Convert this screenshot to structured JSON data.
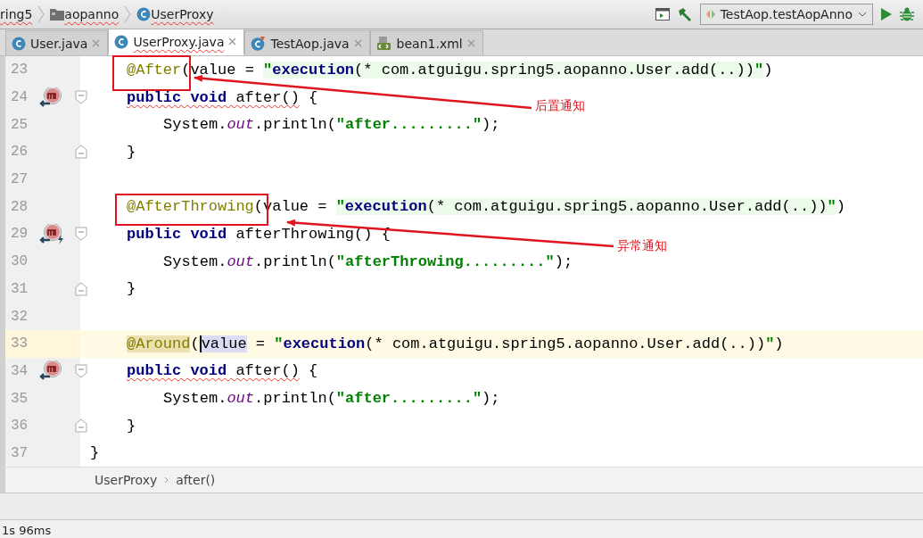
{
  "nav_bar": {
    "breadcrumbs": [
      {
        "label": "ring5",
        "kind": "module"
      },
      {
        "label": "aopanno",
        "kind": "package"
      },
      {
        "label": "UserProxy",
        "kind": "class"
      }
    ],
    "run_config": "TestAop.testAopAnno"
  },
  "tabs": [
    {
      "label": "User.java",
      "kind": "class",
      "selected": false
    },
    {
      "label": "UserProxy.java",
      "kind": "class",
      "selected": true
    },
    {
      "label": "TestAop.java",
      "kind": "test",
      "selected": false
    },
    {
      "label": "bean1.xml",
      "kind": "xml",
      "selected": false
    }
  ],
  "editor": {
    "lines": [
      {
        "number": "23",
        "current": false,
        "kind": "member",
        "tokens": [
          {
            "t": "@After",
            "kind": "annotation"
          },
          {
            "t": "(value = ",
            "kind": "plain"
          },
          {
            "t": "\"",
            "kind": "string-pc"
          },
          {
            "t": "execution",
            "kind": "pc-keyword"
          },
          {
            "t": "(* com.atguigu.spring5.aopanno.User.add(..))",
            "kind": "pc"
          },
          {
            "t": "\"",
            "kind": "string-pc"
          },
          {
            "t": ")",
            "kind": "plain"
          }
        ]
      },
      {
        "number": "24",
        "current": false,
        "kind": "member",
        "marker": {
          "kind": "override"
        },
        "fold": {
          "kind": "start"
        },
        "tokens": [
          {
            "t": "public void",
            "kind": "keyword",
            "squiggle": true
          },
          {
            "t": " after()",
            "kind": "plain",
            "squiggle": true
          },
          {
            "t": " {",
            "kind": "plain"
          }
        ]
      },
      {
        "number": "25",
        "current": false,
        "kind": "statement",
        "tokens": [
          {
            "t": "System.",
            "kind": "plain"
          },
          {
            "t": "out",
            "kind": "field"
          },
          {
            "t": ".println(",
            "kind": "plain"
          },
          {
            "t": "\"after.........\"",
            "kind": "string"
          },
          {
            "t": ");",
            "kind": "plain"
          }
        ]
      },
      {
        "number": "26",
        "current": false,
        "kind": "member",
        "fold": {
          "kind": "end"
        },
        "tokens": [
          {
            "t": "}",
            "kind": "plain"
          }
        ]
      },
      {
        "number": "27",
        "current": false
      },
      {
        "number": "28",
        "current": false,
        "kind": "member",
        "tokens": [
          {
            "t": "@AfterThrowing",
            "kind": "annotation"
          },
          {
            "t": "(value = ",
            "kind": "plain"
          },
          {
            "t": "\"",
            "kind": "string-pc"
          },
          {
            "t": "execution",
            "kind": "pc-keyword"
          },
          {
            "t": "(* com.atguigu.spring5.aopanno.User.add(..))",
            "kind": "pc"
          },
          {
            "t": "\"",
            "kind": "string-pc"
          },
          {
            "t": ")",
            "kind": "plain"
          }
        ]
      },
      {
        "number": "29",
        "current": false,
        "kind": "member",
        "marker": {
          "kind": "override-throws"
        },
        "fold": {
          "kind": "start"
        },
        "tokens": [
          {
            "t": "public void",
            "kind": "keyword"
          },
          {
            "t": " afterThrowing() {",
            "kind": "plain"
          }
        ]
      },
      {
        "number": "30",
        "current": false,
        "kind": "statement",
        "tokens": [
          {
            "t": "System.",
            "kind": "plain"
          },
          {
            "t": "out",
            "kind": "field"
          },
          {
            "t": ".println(",
            "kind": "plain"
          },
          {
            "t": "\"afterThrowing.........\"",
            "kind": "string"
          },
          {
            "t": ");",
            "kind": "plain"
          }
        ]
      },
      {
        "number": "31",
        "current": false,
        "kind": "member",
        "fold": {
          "kind": "end"
        },
        "tokens": [
          {
            "t": "}",
            "kind": "plain"
          }
        ]
      },
      {
        "number": "32",
        "current": false
      },
      {
        "number": "33",
        "current": true,
        "kind": "member",
        "tokens": [
          {
            "t": "@Around",
            "kind": "annotation-match"
          },
          {
            "t": "(",
            "kind": "plain"
          },
          {
            "t": "value",
            "kind": "usage-caret"
          },
          {
            "t": " = ",
            "kind": "plain"
          },
          {
            "t": "\"",
            "kind": "string"
          },
          {
            "t": "execution",
            "kind": "keyword"
          },
          {
            "t": "(* com.atguigu.spring5.aopanno.User.add(..))",
            "kind": "plain"
          },
          {
            "t": "\"",
            "kind": "string"
          },
          {
            "t": ")",
            "kind": "plain"
          }
        ]
      },
      {
        "number": "34",
        "current": false,
        "kind": "member",
        "marker": {
          "kind": "override"
        },
        "fold": {
          "kind": "start"
        },
        "tokens": [
          {
            "t": "public void",
            "kind": "keyword",
            "squiggle": true
          },
          {
            "t": " after()",
            "kind": "plain",
            "squiggle": true
          },
          {
            "t": " {",
            "kind": "plain"
          }
        ]
      },
      {
        "number": "35",
        "current": false,
        "kind": "statement",
        "tokens": [
          {
            "t": "System.",
            "kind": "plain"
          },
          {
            "t": "out",
            "kind": "field"
          },
          {
            "t": ".println(",
            "kind": "plain"
          },
          {
            "t": "\"after.........\"",
            "kind": "string"
          },
          {
            "t": ");",
            "kind": "plain"
          }
        ]
      },
      {
        "number": "36",
        "current": false,
        "kind": "member",
        "fold": {
          "kind": "end"
        },
        "tokens": [
          {
            "t": "}",
            "kind": "plain"
          }
        ]
      },
      {
        "number": "37",
        "current": false,
        "kind": "class",
        "tokens": [
          {
            "t": "}",
            "kind": "plain"
          }
        ]
      }
    ],
    "callouts": [
      {
        "label": "后置通知"
      },
      {
        "label": "异常通知"
      }
    ],
    "breadcrumbs": [
      "UserProxy",
      "after()"
    ]
  },
  "status_bar": {
    "message": "1s 96ms"
  }
}
